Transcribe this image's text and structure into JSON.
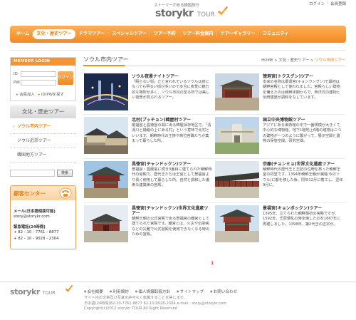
{
  "top_links": {
    "login": "ログイン",
    "separator": "|",
    "register": "会員登録"
  },
  "logo": {
    "subtitle": "ストーリーがある韓国旅行",
    "brand": "storykr",
    "brand_suffix": "TOUR"
  },
  "nav": [
    {
      "label": "ホーム",
      "active": false
    },
    {
      "label": "文化・歴史ツアー",
      "active": true
    },
    {
      "label": "ドラマツアー",
      "active": false
    },
    {
      "label": "スペシャルツアー",
      "active": false
    },
    {
      "label": "ツアー予約",
      "active": false
    },
    {
      "label": "ツアー料金案内",
      "active": false
    },
    {
      "label": "ツアーギャラリー",
      "active": false
    },
    {
      "label": "コミュニティ",
      "active": false
    }
  ],
  "login": {
    "title": "MEMBER LOGIN",
    "id_label": "ID",
    "pw_label": "PW",
    "button": "ログイン",
    "join_link": "会員加入",
    "find_link": "ID/PWを探す"
  },
  "sidebar": {
    "section_title": "文化・歴史ツアー",
    "items": [
      {
        "label": "ソウル市内ツアー",
        "active": true
      },
      {
        "label": "ソウル近郊ツアー",
        "active": false
      },
      {
        "label": "韓国地方ツアー",
        "active": false
      }
    ],
    "search_button": "検索"
  },
  "customer_center": {
    "title": "顧客センター",
    "email_label": "メール(日本語相談可能)",
    "email": "story@storykr.com",
    "phone_label": "緊急電話(24時間)",
    "phones": [
      "+ 82 - 10 - 7761 - 8877",
      "+ 82 - 10 - 9028 - 2304"
    ]
  },
  "main": {
    "title": "ソウル市内ツアー",
    "breadcrumb": {
      "home": "HOME",
      "sep1": " > ",
      "section": "文化・歴史ツアー",
      "sep2": " > ",
      "current": "ソウル市内ツアー"
    }
  },
  "tours": [
    {
      "title": "ソウル夜景ナイトツアー",
      "desc": "「眠らない街」だと言われているソウルは夜になっても明るい街が多いので本当に夜景に魅力的な場所が多く、ソウル市内の至る所では美しい夜景が見られるツアー。",
      "thumb": "night"
    },
    {
      "title": "徳寿宮(トクスグン)ツアー",
      "desc": "本来の名称は慶運宮(キョンウングン)で最初は朝鮮宮殿として使われました。宮殿らしい建物を備えたのは朝鮮末期からで、西洋式の建物と伝統建築が調和をなしています。",
      "thumb": "palace"
    },
    {
      "title": "北村(プッチョン)韓屋村ツアー",
      "desc": "慶福宮と昌徳宮の間にある韓屋保存地区で、「清渓川と鍾路の上にある村」という意味で北村といいます。朝鮮時代の王族や高位官職たちが集まって暮らした所。",
      "thumb": "village"
    },
    {
      "title": "国立中央博物館ツアー",
      "desc": "アジアにある美術館の中で一番規模が大きくて中心的な博物館。地下1階地上6階の建物は二つの建物が一つのように繋がって、展示空間と遺物の保管空間、研究空間。",
      "thumb": "museum"
    },
    {
      "title": "昌徳宮(チャンドックン)ツアー",
      "desc": "景福宮・昌慶宮に続き3番目に建てられた朝鮮時代の宮殿で、歴代王たちは王宮として景福宮より長く使用して暮らした所。自然と調和した優美な建築美の宮殿。",
      "thumb": "changdeok"
    },
    {
      "title": "宗廟(チョンミョ)世界文化遺産ツアー",
      "desc": "朝鮮時代の歴代王と王妃の位牌を祭った朝鮮王室の祠堂です。1394年朝鮮王朝が漢陽(今のソウル)に都を移した後、同年12月に着工し、翌年9月に。",
      "thumb": "jongmyo"
    },
    {
      "title": "昌徳宮(チャンドックン)世界文化遺産ツアー",
      "desc": "朝鮮王朝の公式宮殿である景福宮の離宮として建てられた宮殿です。離宮とは、火災や伝染病などの災難で公式宮殿を使用できなくなる時のための宮殿。",
      "thumb": "changdeok2"
    },
    {
      "title": "景福宮(キョンボックン)ツアー",
      "desc": "1395年、立てられた朝鮮最初の宮殿ですが、1592年、壬辰倭乱の時全焼したのを1867年に再建しました。1398年、第2代王の正宗が。",
      "thumb": "gyeongbok"
    }
  ],
  "pagination": {
    "current": "1"
  },
  "footer": {
    "brand": "storykr",
    "brand_suffix": "TOUR",
    "links": [
      "会社概要",
      "利用規約",
      "個人情報取扱方針",
      "サイトマップ",
      "お問い合わせ"
    ],
    "line1": "サイト内の文章及び写真を許可なく転載することを禁じます。",
    "line2": "日本語(24時間)82-10-7761-8877 82-10-9028-2304  e-mail : story@storykr.com",
    "line3": "Copyright(c)2012 storykr TOUR All Right Reserved"
  },
  "colors": {
    "accent": "#f28a1e",
    "nav_gradient_top": "#fbb05b",
    "nav_gradient_bottom": "#f28a1e",
    "active_text": "#e8801a",
    "page_current": "#ee3333"
  }
}
